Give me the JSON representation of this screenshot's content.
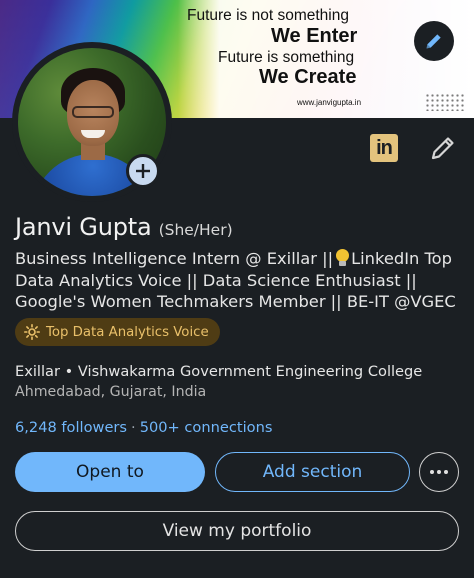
{
  "banner": {
    "quote_line1": "Future is not something",
    "quote_line2": "We Enter",
    "quote_line3": "Future is something",
    "quote_line4": "We Create",
    "website": "www.janvigupta.in"
  },
  "icons": {
    "banner_edit": "pencil-icon",
    "avatar_add": "plus-icon",
    "linkedin": "linkedin-icon",
    "profile_edit": "pencil-icon",
    "badge": "sun-icon",
    "headline_bulb": "lightbulb-icon",
    "more": "ellipsis-icon",
    "linkedin_text": "in"
  },
  "profile": {
    "name": "Janvi Gupta",
    "pronouns": "(She/Her)",
    "headline_part1": "Business Intelligence Intern @ Exillar ||",
    "headline_part2": "LinkedIn Top Data Analytics Voice || Data Science Enthusiast || Google's Women Techmakers Member || BE-IT @VGEC",
    "badge": "Top Data Analytics Voice",
    "education_line": "Exillar • Vishwakarma Government Engineering College",
    "location": "Ahmedabad, Gujarat, India",
    "followers": "6,248 followers",
    "separator": "·",
    "connections": "500+ connections"
  },
  "actions": {
    "open_to": "Open to",
    "add_section": "Add section",
    "view_portfolio": "View my portfolio"
  },
  "colors": {
    "background": "#1b1f23",
    "accent_blue": "#71b7fb",
    "badge_bg": "#4f3c14",
    "badge_text": "#e9c06a",
    "linkedin_icon": "#e3c37d"
  }
}
